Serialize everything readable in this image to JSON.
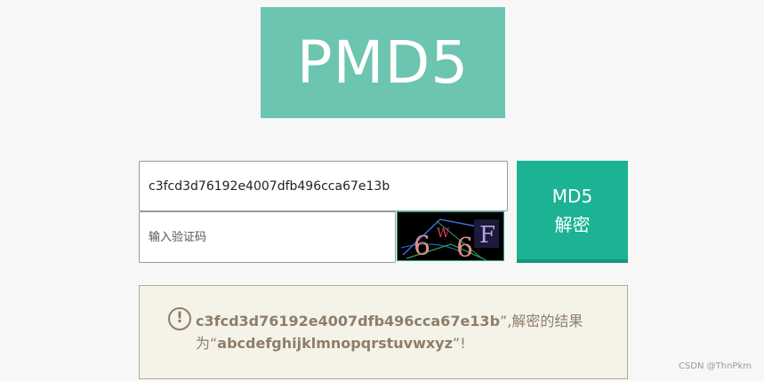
{
  "logo": {
    "text": "PMD5"
  },
  "form": {
    "hash_value": "c3fcd3d76192e4007dfb496cca67e13b",
    "captcha_placeholder": "输入验证码",
    "captcha_chars": [
      "6",
      "W",
      "6",
      "F"
    ],
    "button_line1": "MD5",
    "button_line2": "解密"
  },
  "result": {
    "hash": "c3fcd3d76192e4007dfb496cca67e13b",
    "mid_text": "”,解密的结果为“",
    "plaintext": "abcdefghijklmnopqrstuvwxyz",
    "end_text": "”!"
  },
  "watermark": "CSDN @ThnPkm",
  "colors": {
    "logo_bg": "#6cc5b0",
    "button_bg": "#1bb394",
    "result_bg": "#f5f3e7",
    "result_text": "#8d7e6b"
  }
}
